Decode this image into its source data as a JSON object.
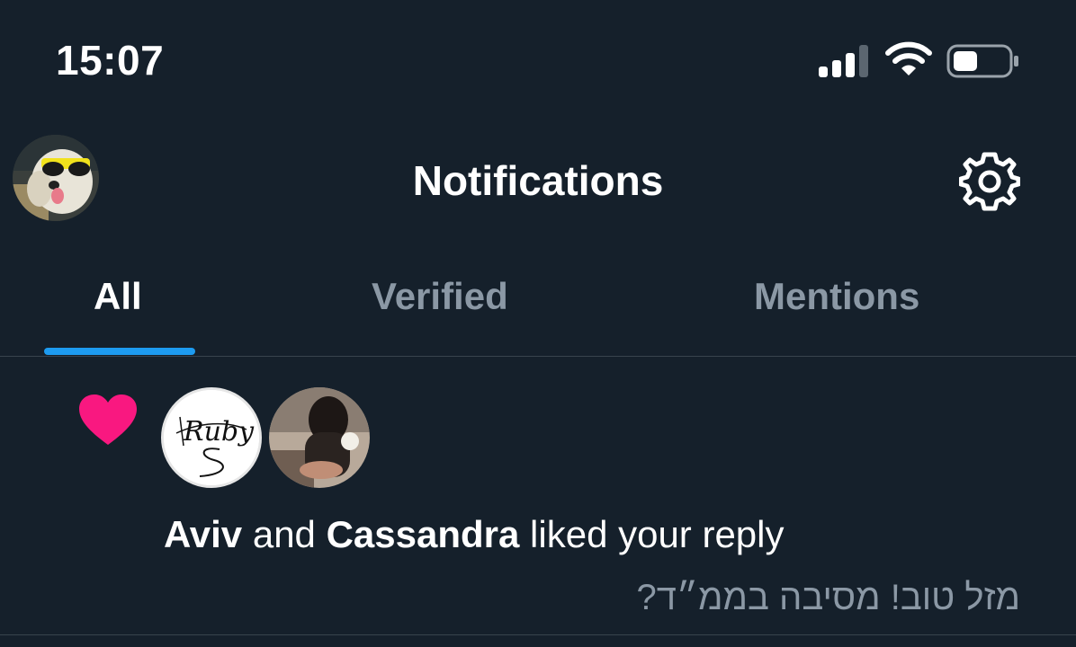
{
  "status_bar": {
    "time": "15:07",
    "icons": [
      "cellular-signal-icon",
      "wifi-icon",
      "battery-icon"
    ]
  },
  "header": {
    "title": "Notifications",
    "left_icon": "profile-avatar",
    "right_icon": "gear-icon"
  },
  "tabs": [
    {
      "label": "All",
      "active": true
    },
    {
      "label": "Verified",
      "active": false
    },
    {
      "label": "Mentions",
      "active": false
    }
  ],
  "notifications": [
    {
      "type_icon": "heart-icon",
      "user1": "Aviv",
      "conj": " and ",
      "user2": "Cassandra",
      "action": " liked your reply",
      "reply_text": "מזל טוב! מסיבה בממ״ד?",
      "avatar1_text": "Ruby"
    }
  ],
  "colors": {
    "background": "#15202b",
    "accent": "#1d9bf0",
    "like": "#f91880",
    "muted_text": "#8b98a5",
    "divider": "#38444d"
  }
}
